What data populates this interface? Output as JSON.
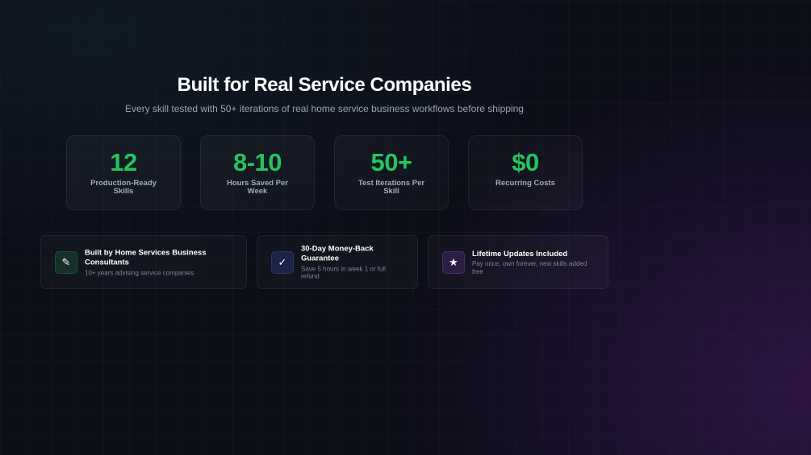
{
  "header": {
    "title": "Built for Real Service Companies",
    "subtitle": "Every skill tested with 50+ iterations of real home service business workflows before shipping"
  },
  "stats": [
    {
      "value": "12",
      "label": "Production-Ready Skills"
    },
    {
      "value": "8-10",
      "label": "Hours Saved Per Week"
    },
    {
      "value": "50+",
      "label": "Test Iterations Per Skill"
    },
    {
      "value": "$0",
      "label": "Recurring Costs"
    }
  ],
  "features": [
    {
      "icon": "pencil-icon",
      "glyph": "✎",
      "color": "#16302a",
      "title": "Built by Home Services Business Consultants",
      "desc": "10+ years advising service companies"
    },
    {
      "icon": "checkmark-icon",
      "glyph": "✓",
      "color": "#1b2447",
      "title": "30-Day Money-Back Guarantee",
      "desc": "Save 5 hours in week 1 or full refund"
    },
    {
      "icon": "star-icon",
      "glyph": "★",
      "color": "#2c1d45",
      "title": "Lifetime Updates Included",
      "desc": "Pay once, own forever, new skills added free"
    }
  ],
  "colors": {
    "accent": "#22c55e",
    "background": "#0c0e18"
  }
}
